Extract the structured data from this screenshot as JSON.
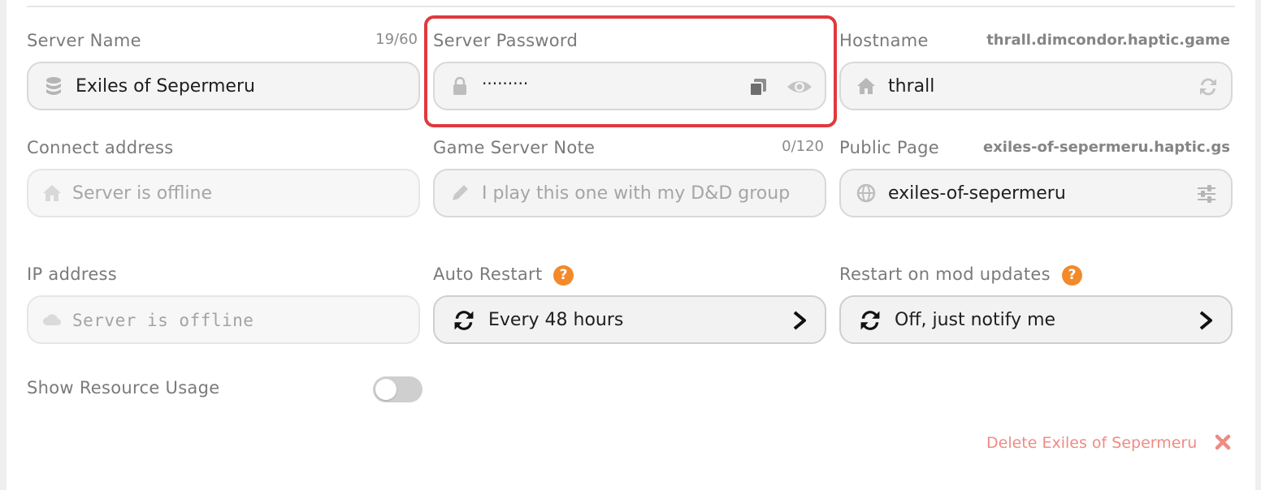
{
  "server_name": {
    "label": "Server Name",
    "counter": "19/60",
    "value": "Exiles of Sepermeru",
    "icon": "coin-stack-icon"
  },
  "server_password": {
    "label": "Server Password",
    "value": "·········",
    "icons": [
      "lock-icon",
      "copy-icon",
      "eye-icon"
    ]
  },
  "hostname": {
    "label": "Hostname",
    "aux": "thrall.dimcondor.haptic.game",
    "value": "thrall",
    "icons": [
      "home-icon",
      "refresh-icon"
    ]
  },
  "connect_address": {
    "label": "Connect address",
    "placeholder": "Server is offline",
    "icon": "home-icon"
  },
  "game_server_note": {
    "label": "Game Server Note",
    "counter": "0/120",
    "placeholder": "I play this one with my D&D group",
    "icon": "pencil-icon"
  },
  "public_page": {
    "label": "Public Page",
    "aux": "exiles-of-sepermeru.haptic.gs",
    "value": "exiles-of-sepermeru",
    "icons": [
      "globe-icon",
      "sliders-icon"
    ]
  },
  "ip_address": {
    "label": "IP address",
    "placeholder": "Server is offline",
    "icon": "cloud-icon"
  },
  "auto_restart": {
    "label": "Auto Restart",
    "help": "?",
    "value": "Every 48 hours"
  },
  "restart_mod_updates": {
    "label": "Restart on mod updates",
    "help": "?",
    "value": "Off, just notify me"
  },
  "resource_usage": {
    "label": "Show Resource Usage",
    "enabled": false
  },
  "delete": {
    "label": "Delete Exiles of Sepermeru"
  },
  "colors": {
    "highlight": "#e0393e",
    "help": "#f28a2a",
    "delete": "#ee8c83"
  }
}
